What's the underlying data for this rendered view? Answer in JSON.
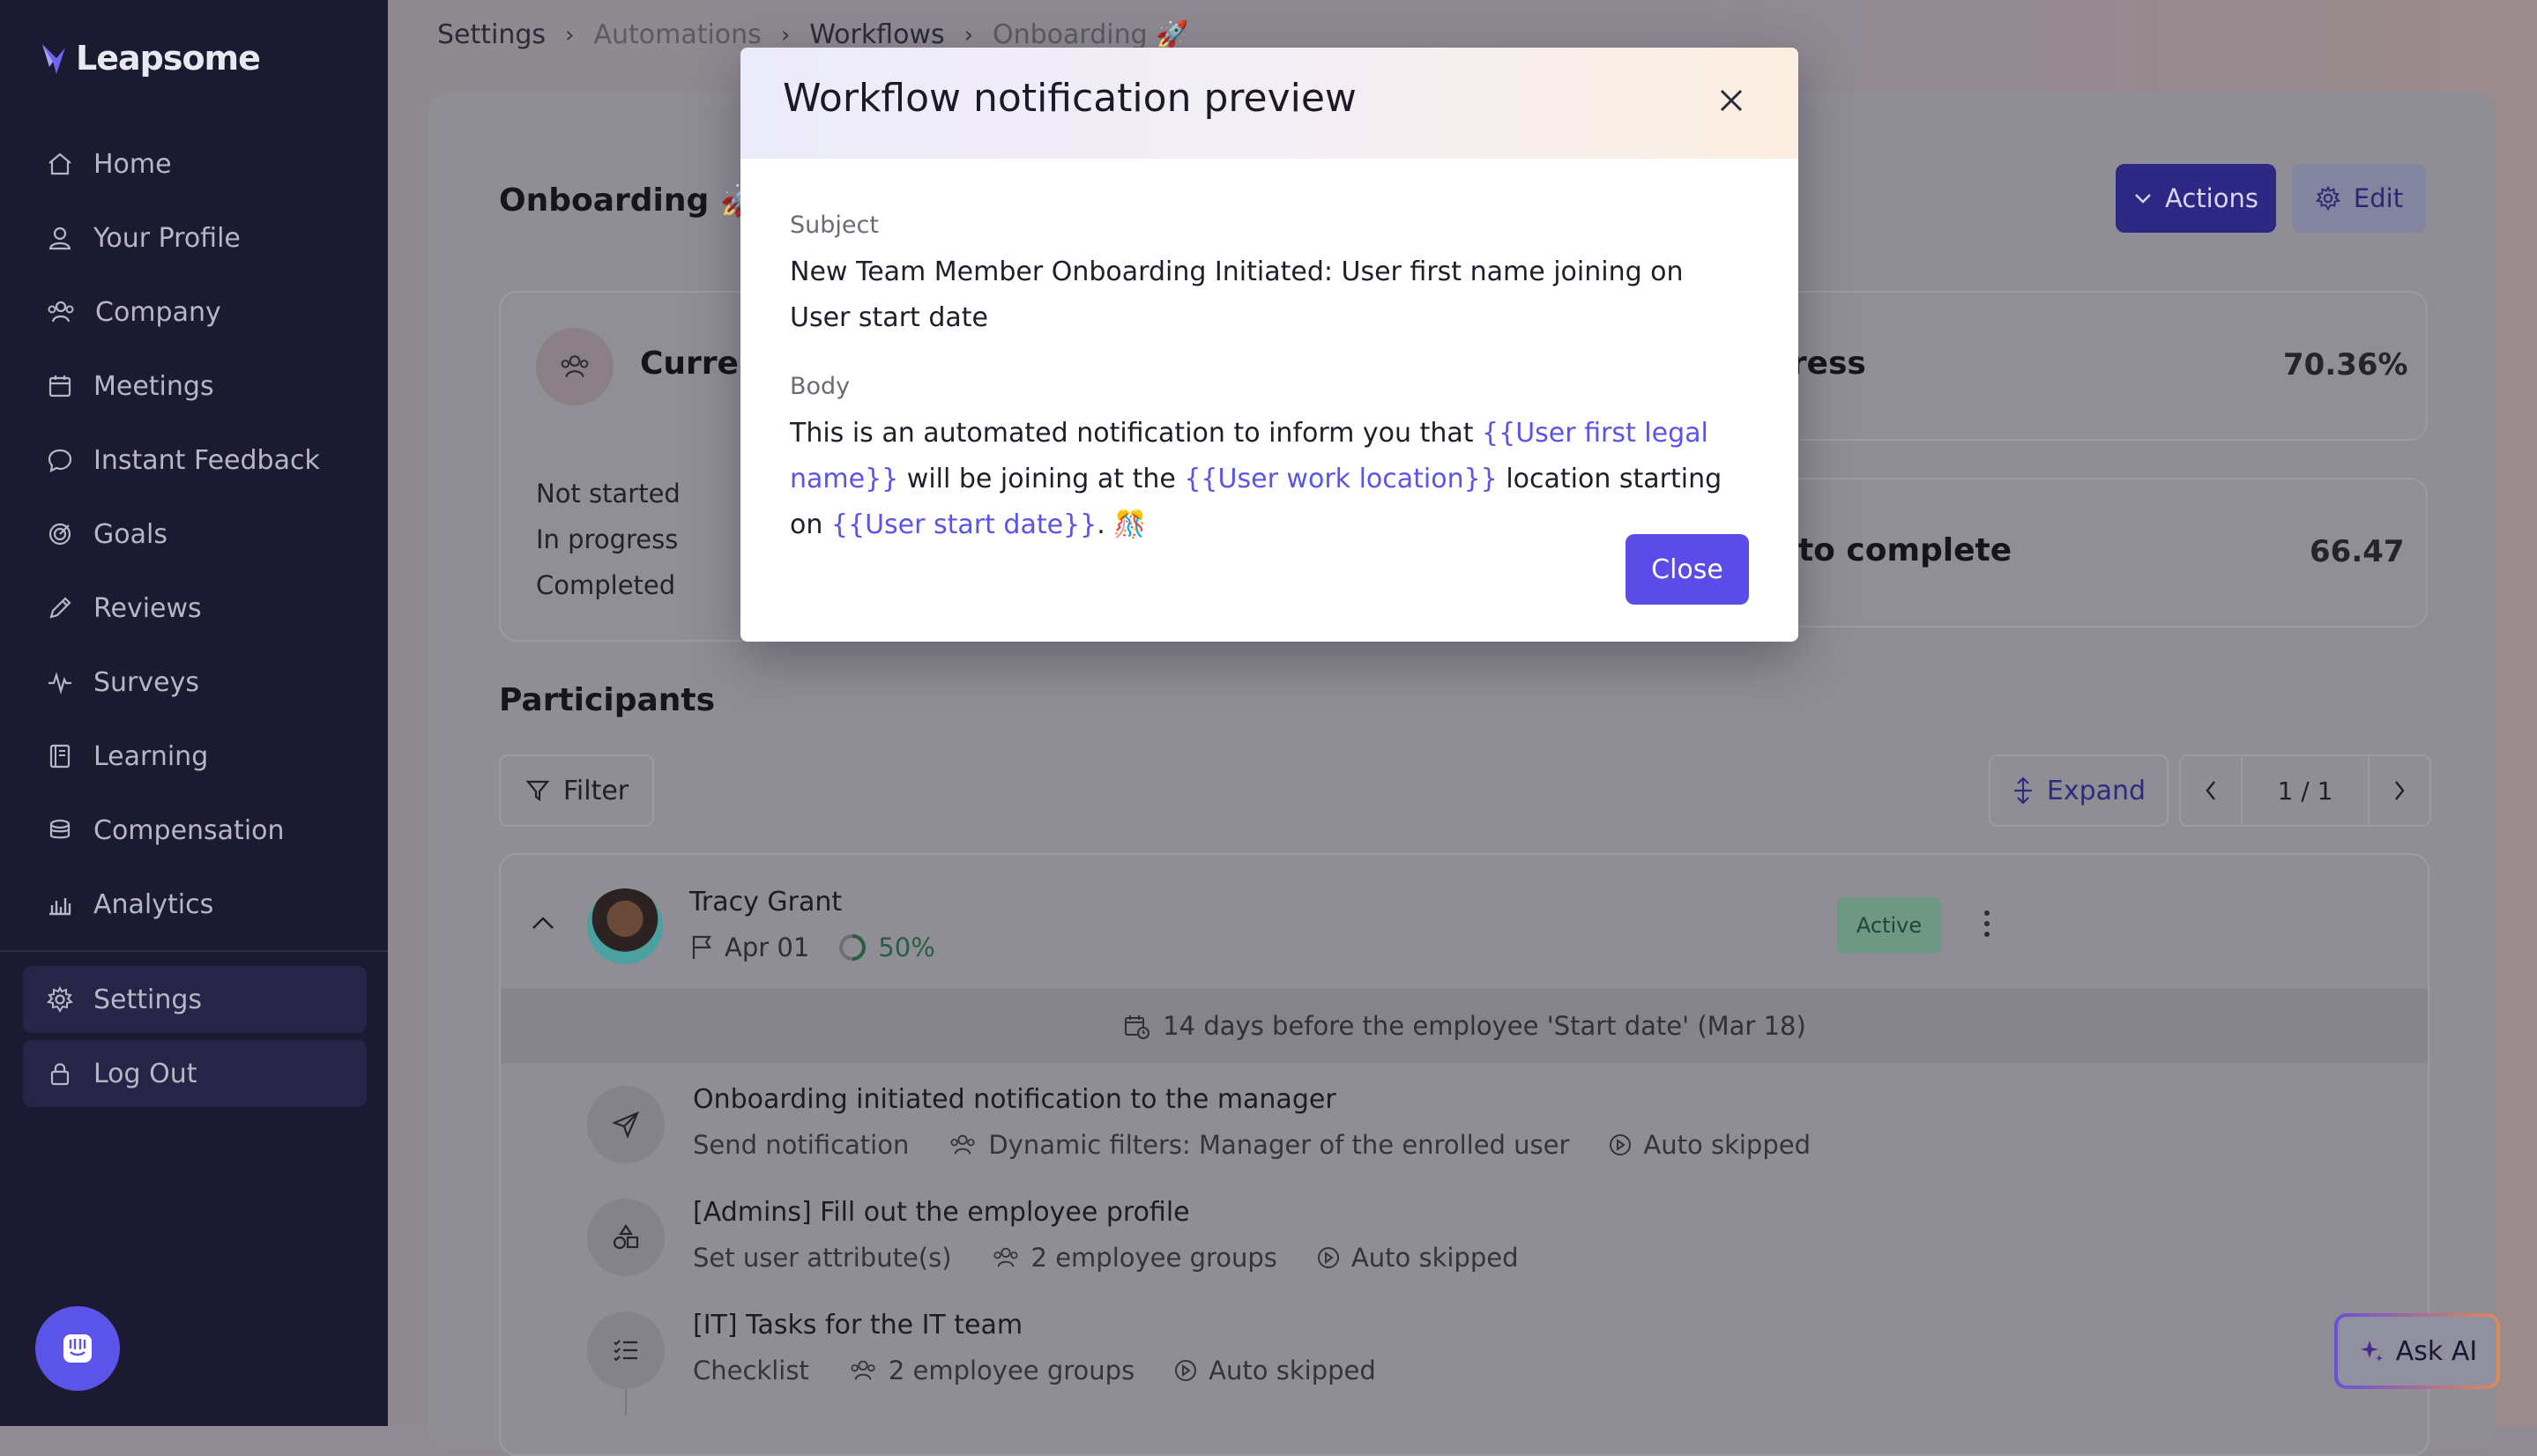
{
  "app": {
    "name": "Leapsome"
  },
  "sidebar": {
    "items": [
      {
        "label": "Home",
        "icon": "home-icon"
      },
      {
        "label": "Your Profile",
        "icon": "user-icon"
      },
      {
        "label": "Company",
        "icon": "users-icon"
      },
      {
        "label": "Meetings",
        "icon": "calendar-icon"
      },
      {
        "label": "Instant Feedback",
        "icon": "chat-icon"
      },
      {
        "label": "Goals",
        "icon": "target-icon"
      },
      {
        "label": "Reviews",
        "icon": "pencil-icon"
      },
      {
        "label": "Surveys",
        "icon": "pulse-icon"
      },
      {
        "label": "Learning",
        "icon": "book-icon"
      },
      {
        "label": "Compensation",
        "icon": "coins-icon"
      },
      {
        "label": "Analytics",
        "icon": "bar-chart-icon"
      }
    ],
    "bottom_items": [
      {
        "label": "Settings",
        "icon": "gear-icon"
      },
      {
        "label": "Log Out",
        "icon": "lock-icon"
      }
    ]
  },
  "breadcrumb": {
    "items": [
      "Settings",
      "Automations",
      "Workflows",
      "Onboarding 🚀"
    ]
  },
  "page": {
    "title": "Onboarding 🚀",
    "actions_label": "Actions",
    "edit_label": "Edit"
  },
  "stats": {
    "current_label": "Curren",
    "rows": [
      "Not started",
      "In progress",
      "Completed"
    ],
    "progress_label": "gress",
    "progress_value": "70.36%",
    "complete_label": "s to complete",
    "complete_value": "66.47"
  },
  "participants": {
    "title": "Participants",
    "filter_label": "Filter",
    "expand_label": "Expand",
    "page_indicator": "1 / 1",
    "row": {
      "name": "Tracy Grant",
      "date": "Apr 01",
      "progress_text": "50%",
      "progress_value": 0.5,
      "status": "Active",
      "date_row": "14 days before the employee 'Start date' (Mar 18)"
    },
    "steps": [
      {
        "title": "Onboarding initiated notification to the manager",
        "type": "Send notification",
        "audience": "Dynamic filters: Manager of the enrolled user",
        "status": "Auto skipped",
        "icon": "send-icon"
      },
      {
        "title": "[Admins] Fill out the employee profile",
        "type": "Set user attribute(s)",
        "audience": "2 employee groups",
        "status": "Auto skipped",
        "icon": "shapes-icon"
      },
      {
        "title": "[IT] Tasks for the IT team",
        "type": "Checklist",
        "audience": "2 employee groups",
        "status": "Auto skipped",
        "icon": "checklist-icon"
      }
    ]
  },
  "ask_ai": {
    "label": "Ask AI"
  },
  "modal": {
    "title": "Workflow notification preview",
    "subject_label": "Subject",
    "subject_text": "New Team Member Onboarding Initiated: User first name joining on User start date",
    "body_label": "Body",
    "body_parts": {
      "p1": "This is an automated notification to inform you that ",
      "v1": "{{User first legal name}}",
      "p2": " will be joining at the ",
      "v2": "{{User work location}}",
      "p3": " location starting on ",
      "v3": "{{User start date}}",
      "p4": ". 🎊"
    },
    "close_label": "Close"
  },
  "colors": {
    "sidebar_bg": "#1b1a31",
    "accent": "#5b54e8",
    "variable_text": "#5b54e8",
    "active_badge": "#6f9884"
  }
}
